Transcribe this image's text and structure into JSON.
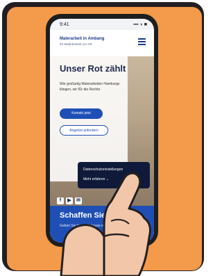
{
  "status_bar": {
    "time": "9:41",
    "signal": "▪▪▪ ◗ ■"
  },
  "header": {
    "brand_line1": "Malerarbeit in Ambang",
    "brand_line2": "Ihr Malerbetrieb vor Ort"
  },
  "hero": {
    "title": "Unser Rot zählt",
    "lead": "Wie großartig Malerarbeiten Hamburgs klingen, wir fÜr die Rechte",
    "primary_button": "Kontakt jetzt",
    "secondary_button": "Angebot anfordern"
  },
  "tooltip": {
    "line1": "Datenschutzeinstellungen",
    "line2": "Mehr erfahren ⌄"
  },
  "social": {
    "items": [
      "f",
      "▶",
      "✉"
    ]
  },
  "band": {
    "title": "Schaffen Sie Ihr",
    "text": "Geben Sie Ihrem Zuhause neue Farbe"
  },
  "colors": {
    "background_orange": "#f39a4b",
    "brand_blue": "#1f4fb5",
    "dark_navy": "#0f1a3a",
    "skin": "#f2c6a8"
  }
}
